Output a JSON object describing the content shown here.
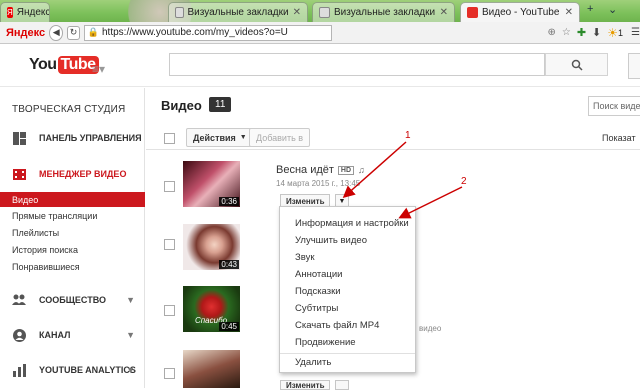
{
  "browser": {
    "tabs": [
      {
        "label": "Яндекс",
        "active": false
      },
      {
        "label": "Визуальные закладки",
        "active": false
      },
      {
        "label": "Визуальные закладки",
        "active": false
      },
      {
        "label": "Видео - YouTube",
        "active": true
      }
    ],
    "brand": "Яндекс",
    "url": "https://www.youtube.com/my_videos?o=U",
    "weather": "1",
    "tab_count": "1"
  },
  "youtube": {
    "logo_you": "You",
    "logo_tube": "Tube"
  },
  "sidebar": {
    "studio_title": "ТВОРЧЕСКАЯ СТУДИЯ",
    "dashboard": "ПАНЕЛЬ УПРАВЛЕНИЯ",
    "video_manager": "МЕНЕДЖЕР ВИДЕО",
    "sub_items": [
      "Видео",
      "Прямые трансляции",
      "Плейлисты",
      "История поиска",
      "Понравившиеся"
    ],
    "community": "СООБЩЕСТВО",
    "channel": "КАНАЛ",
    "analytics": "YOUTUBE ANALYTICS"
  },
  "main": {
    "title": "Видео",
    "count": "11",
    "filter_placeholder": "Поиск видео",
    "actions_label": "Действия",
    "add_to_label": "Добавить в",
    "show_label": "Показат",
    "video1": {
      "title": "Весна идёт",
      "hd": "HD",
      "date": "14 марта 2015 г., 13:45",
      "duration": "0:36"
    },
    "video2_duration": "0:43",
    "video3_duration": "0:45",
    "video3_text": "Спасибо",
    "video3_side": "видео",
    "edit_label": "Изменить"
  },
  "dropdown": {
    "items": [
      "Информация и настройки",
      "Улучшить видео",
      "Звук",
      "Аннотации",
      "Подсказки",
      "Субтитры",
      "Скачать файл MP4",
      "Продвижение",
      "Удалить"
    ]
  },
  "annotations": {
    "one": "1",
    "two": "2"
  },
  "colors": {
    "youtube_red": "#e52d27",
    "studio_red": "#cc181e",
    "annotation_red": "#cc0000"
  }
}
